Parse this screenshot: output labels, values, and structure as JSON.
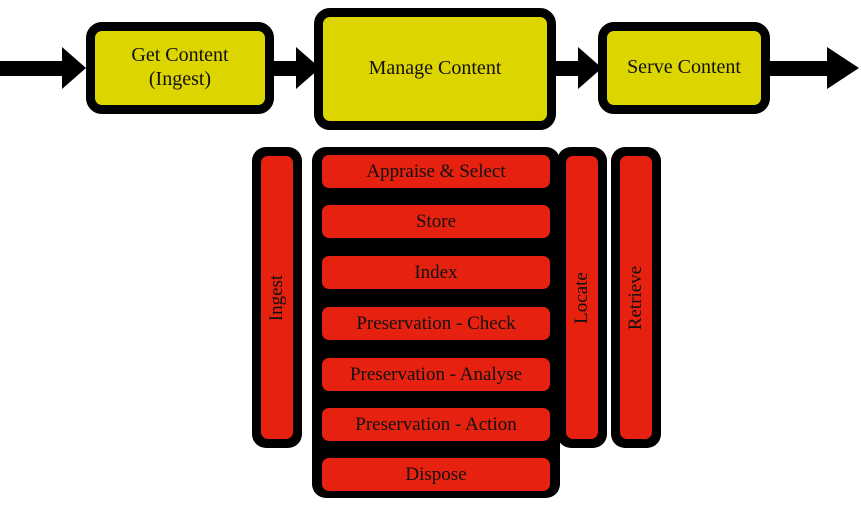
{
  "diagram": {
    "title": "Content lifecycle process diagram",
    "colors": {
      "box_fill": "#DCD500",
      "bar_fill": "#E6210F",
      "outline": "#000000",
      "text": "#111111",
      "background": "#FFFFFF"
    },
    "flow": {
      "boxes": [
        {
          "id": "get-content",
          "label": "Get Content\n(Ingest)"
        },
        {
          "id": "manage-content",
          "label": "Manage Content"
        },
        {
          "id": "serve-content",
          "label": "Serve Content"
        }
      ],
      "arrows": [
        {
          "id": "arrow-in",
          "direction": "right"
        },
        {
          "id": "arrow-get-to-manage",
          "direction": "right"
        },
        {
          "id": "arrow-manage-to-serve",
          "direction": "right"
        },
        {
          "id": "arrow-out",
          "direction": "right"
        }
      ]
    },
    "detail": {
      "ingest_column": {
        "label": "Ingest"
      },
      "manage_column": {
        "items": [
          {
            "id": "appraise-select",
            "label": "Appraise & Select"
          },
          {
            "id": "store",
            "label": "Store"
          },
          {
            "id": "index",
            "label": "Index"
          },
          {
            "id": "preservation-check",
            "label": "Preservation - Check"
          },
          {
            "id": "preservation-analyse",
            "label": "Preservation - Analyse"
          },
          {
            "id": "preservation-action",
            "label": "Preservation - Action"
          },
          {
            "id": "dispose",
            "label": "Dispose"
          }
        ]
      },
      "serve_columns": [
        {
          "id": "locate",
          "label": "Locate"
        },
        {
          "id": "retrieve",
          "label": "Retrieve"
        }
      ]
    }
  }
}
